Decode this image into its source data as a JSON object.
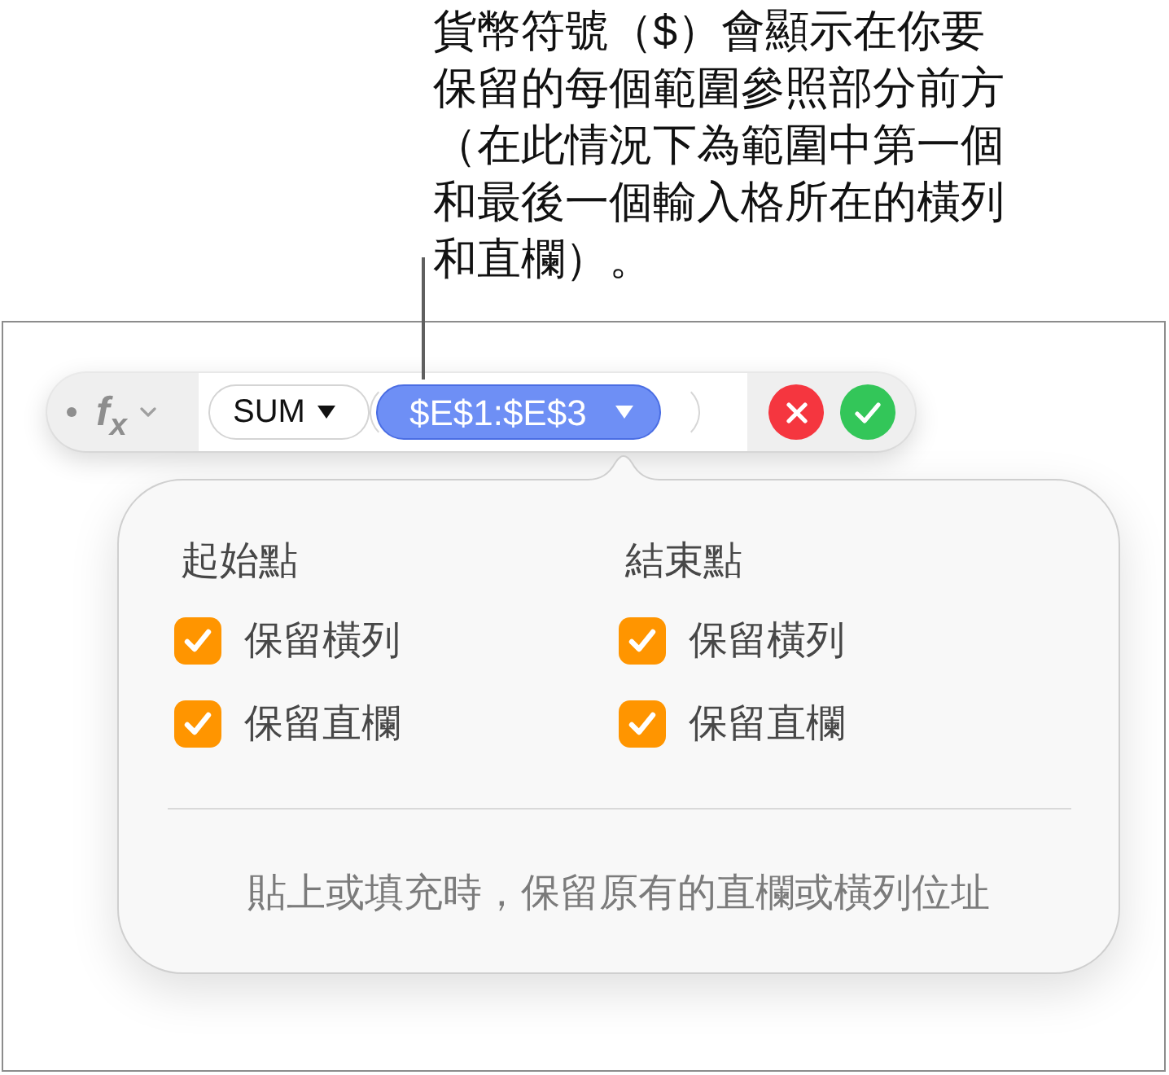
{
  "callout": {
    "text": "貨幣符號（$）會顯示在你要保留的每個範圍參照部分前方（在此情況下為範圍中第一個和最後一個輸入格所在的橫列和直欄）。"
  },
  "formula_bar": {
    "function_symbol": "f$_{x}$",
    "tokens": [
      {
        "kind": "function",
        "text": "SUM",
        "selected": false
      },
      {
        "kind": "range",
        "text": "$E$1:$E$3",
        "selected": true
      }
    ]
  },
  "popover": {
    "groups": [
      {
        "title": "起始點",
        "options": [
          {
            "label": "保留橫列",
            "checked": true
          },
          {
            "label": "保留直欄",
            "checked": true
          }
        ]
      },
      {
        "title": "結束點",
        "options": [
          {
            "label": "保留橫列",
            "checked": true
          },
          {
            "label": "保留直欄",
            "checked": true
          }
        ]
      }
    ],
    "footer": "貼上或填充時，保留原有的直欄或橫列位址"
  }
}
